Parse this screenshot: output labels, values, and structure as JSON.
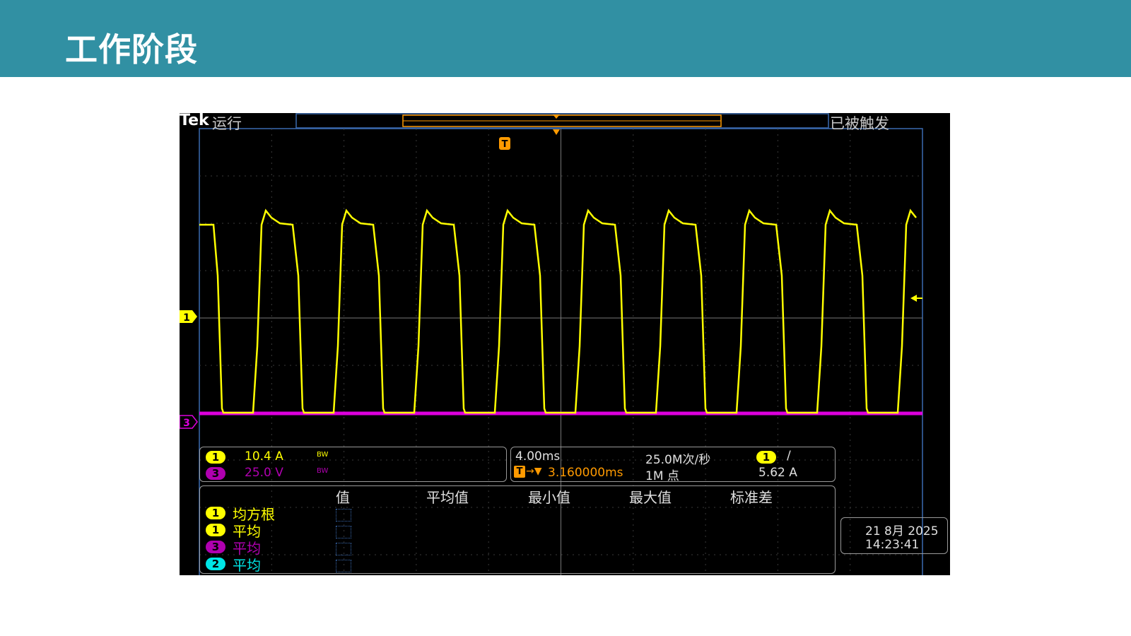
{
  "header": {
    "title": "工作阶段"
  },
  "scope": {
    "brand": "Tek",
    "run_state": "运行",
    "trigger_state": "已被触发",
    "ch1_marker": "1",
    "ch3_marker": "3",
    "trigger_marker": "T",
    "channels": [
      {
        "num": "1",
        "scale": "10.4 A",
        "bw": "BW",
        "color": "#ffff00"
      },
      {
        "num": "3",
        "scale": "25.0 V",
        "bw": "BW",
        "color": "#b000b0"
      }
    ],
    "timebase": "4.00ms",
    "trigger_pos_icon": "T",
    "trigger_pos_arrow": "→▼",
    "trigger_position": "3.160000ms",
    "sample_rate": "25.0M次/秒",
    "record_length": "1M 点",
    "trigger_channel": "1",
    "trigger_slope": "/",
    "trigger_level": "5.62 A",
    "measure_headers": [
      "值",
      "平均值",
      "最小值",
      "最大值",
      "标准差"
    ],
    "measurements": [
      {
        "num": "1",
        "label": "均方根",
        "color": "#ffff00",
        "text_color": "#000000"
      },
      {
        "num": "1",
        "label": "平均",
        "color": "#ffff00",
        "text_color": "#000000"
      },
      {
        "num": "3",
        "label": "平均",
        "color": "#b000b0",
        "text_color": "#ffffff"
      },
      {
        "num": "2",
        "label": "平均",
        "color": "#00e5e5",
        "text_color": "#000000"
      }
    ],
    "date": "21 8月 2025",
    "time": "14:23:41",
    "colors": {
      "ch1": "#ffff00",
      "ch3": "#dd00dd",
      "trigger": "#ff9a00",
      "grid": "#5a5a5a",
      "frame": "#3a6ab0"
    }
  }
}
